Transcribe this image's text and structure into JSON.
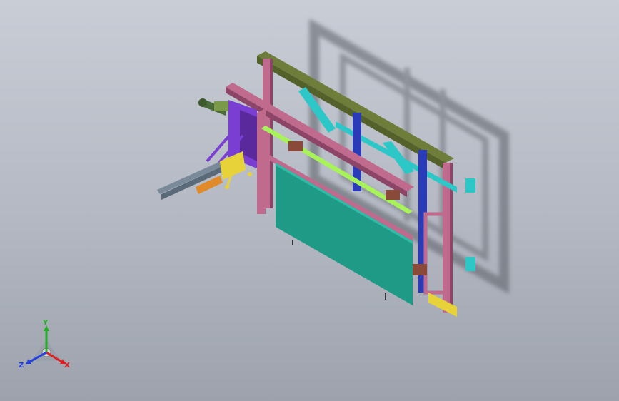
{
  "viewport": {
    "background_top": "#c9cdd6",
    "background_bottom": "#9da2ac"
  },
  "triad": {
    "x_label": "X",
    "y_label": "Y",
    "z_label": "Z",
    "x_color": "#e02020",
    "y_color": "#20b020",
    "z_color": "#2040e0"
  },
  "model": {
    "name": "",
    "icons": [
      "frame-assembly-icon",
      "panel-icon",
      "rail-icon",
      "motor-icon"
    ],
    "colors": {
      "frame_top": "#6f7d3a",
      "frame_side": "#c06a8e",
      "panel": "#1e9a86",
      "cyan_brace": "#2ec7c7",
      "blue_post": "#2a3bb8",
      "purple_plate": "#7a3fd2",
      "guide_rail": "#a8f25a",
      "orange_block": "#e08a2a",
      "yellow_part": "#e8d23a"
    }
  }
}
